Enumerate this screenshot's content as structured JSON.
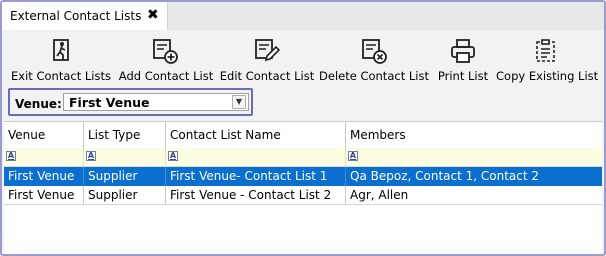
{
  "tab": {
    "title": "External Contact Lists",
    "close_glyph": "✖"
  },
  "toolbar": {
    "buttons": [
      {
        "label": "Exit Contact Lists",
        "icon": "exit-icon"
      },
      {
        "label": "Add Contact List",
        "icon": "add-list-icon"
      },
      {
        "label": "Edit Contact List",
        "icon": "edit-list-icon"
      },
      {
        "label": "Delete Contact List",
        "icon": "delete-list-icon"
      },
      {
        "label": "Print List",
        "icon": "printer-icon"
      },
      {
        "label": "Copy Existing List",
        "icon": "copy-list-icon"
      }
    ]
  },
  "venue": {
    "label": "Venue:",
    "value": "First Venue"
  },
  "grid": {
    "columns": [
      "Venue",
      "List Type",
      "Contact List Name",
      "Members"
    ],
    "filter_glyph": "A",
    "rows": [
      {
        "venue": "First Venue",
        "list_type": "Supplier",
        "name": "First Venue- Contact List 1",
        "members": "Qa Bepoz, Contact 1, Contact 2",
        "selected": true
      },
      {
        "venue": "First Venue",
        "list_type": "Supplier",
        "name": "First Venue - Contact List 2",
        "members": "Agr, Allen",
        "selected": false
      }
    ]
  },
  "colors": {
    "selection": "#0a6fcf",
    "filter_row": "#fcfce0",
    "venue_highlight": "#6b6bb8",
    "frame": "#9a9ad0"
  }
}
